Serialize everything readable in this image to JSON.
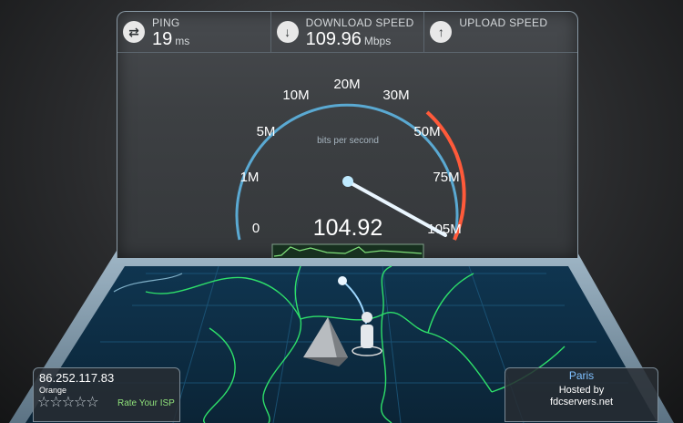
{
  "header": {
    "ping": {
      "label": "PING",
      "value": "19",
      "unit": "ms",
      "icon": "ping-icon"
    },
    "download": {
      "label": "DOWNLOAD SPEED",
      "value": "109.96",
      "unit": "Mbps",
      "icon": "download-arrow-icon"
    },
    "upload": {
      "label": "UPLOAD SPEED",
      "value": "",
      "unit": "",
      "icon": "upload-arrow-icon"
    }
  },
  "gauge": {
    "unit_caption": "bits per second",
    "current_value": "104.92",
    "scale_labels": [
      "0",
      "1M",
      "5M",
      "10M",
      "20M",
      "30M",
      "50M",
      "75M",
      "105M"
    ],
    "needle_value": 104.92,
    "colors": {
      "accent": "#5fd0ff",
      "peak": "#ff5a3a"
    }
  },
  "client": {
    "ip": "86.252.117.83",
    "isp": "Orange",
    "rate_label": "Rate Your ISP",
    "stars_count": 5
  },
  "server": {
    "city": "Paris",
    "hosted_label": "Hosted by",
    "host": "fdcservers.net"
  }
}
